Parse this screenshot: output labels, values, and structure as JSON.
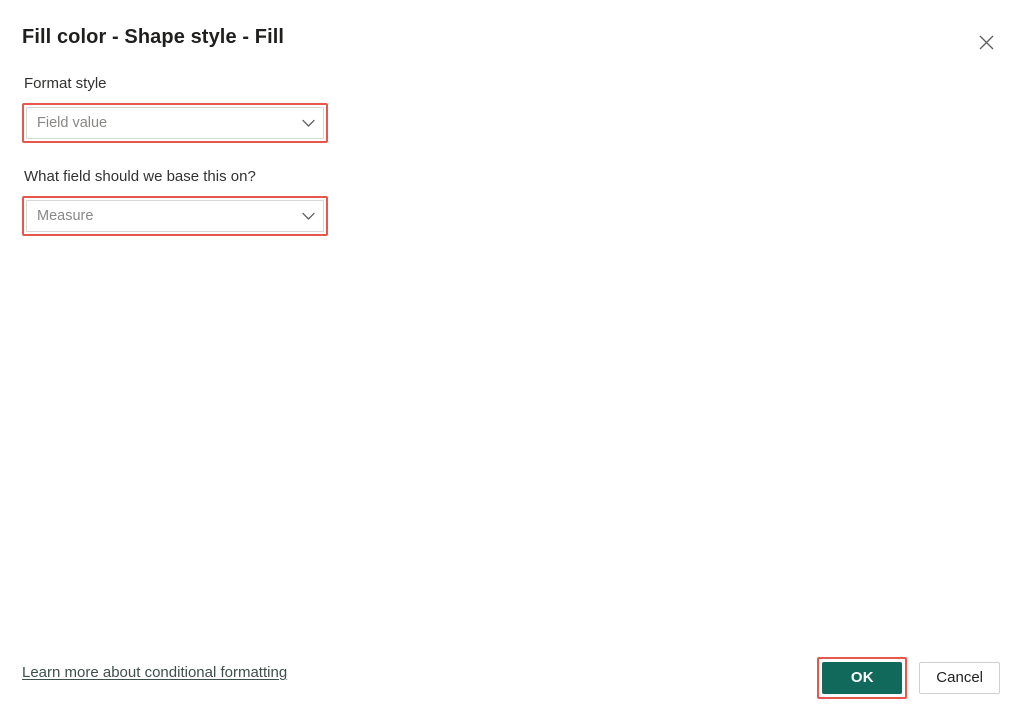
{
  "dialog": {
    "title": "Fill color - Shape style - Fill",
    "close_icon": "close-icon"
  },
  "fields": [
    {
      "label": "Format style",
      "value": "Field value",
      "caret_icon": "chevron-down-icon",
      "highlighted": true
    },
    {
      "label": "What field should we base this on?",
      "value": "Measure",
      "caret_icon": "chevron-down-icon",
      "highlighted": true
    }
  ],
  "footer": {
    "learn_more_link": "Learn more about conditional formatting",
    "ok_label": "OK",
    "cancel_label": "Cancel"
  },
  "colors": {
    "highlight": "#e8574c",
    "primary_button": "#10695a",
    "title_text": "#201f1e",
    "placeholder_text": "#8a8886",
    "link_text": "#3f4f4c",
    "border": "#d7d7d7"
  }
}
